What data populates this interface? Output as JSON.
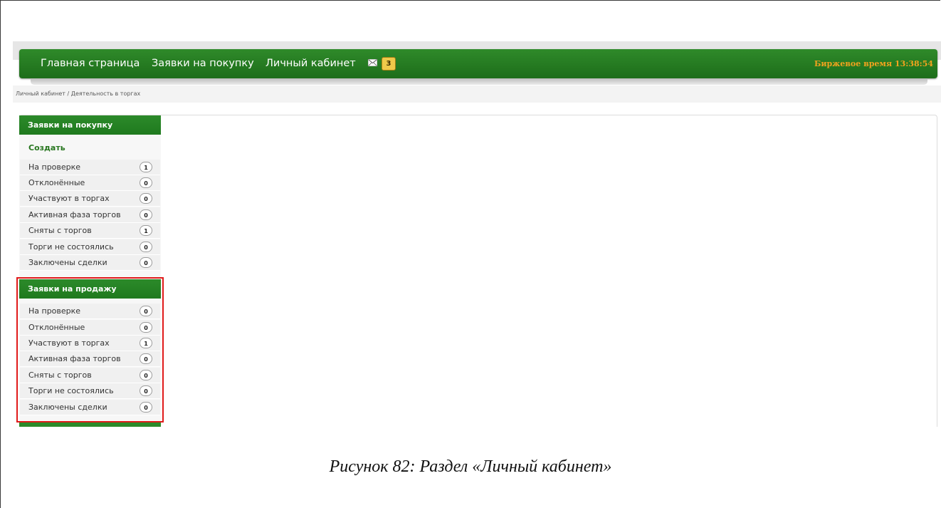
{
  "navbar": {
    "home": "Главная страница",
    "purchase_requests": "Заявки на покупку",
    "personal_account": "Личный кабинет",
    "mail_count": "3",
    "exchange_time": "Биржевое время 13:38:54"
  },
  "breadcrumb": "Личный кабинет / Деятельность в торгах",
  "sidebar": {
    "purchase_header": "Заявки на покупку",
    "create_label": "Создать",
    "purchase_items": [
      {
        "label": "На проверке",
        "count": "1"
      },
      {
        "label": "Отклонённые",
        "count": "0"
      },
      {
        "label": "Участвуют в торгах",
        "count": "0"
      },
      {
        "label": "Активная фаза торгов",
        "count": "0"
      },
      {
        "label": "Сняты с торгов",
        "count": "1"
      },
      {
        "label": "Торги не состоялись",
        "count": "0"
      },
      {
        "label": "Заключены сделки",
        "count": "0"
      }
    ],
    "sale_header": "Заявки на продажу",
    "sale_items": [
      {
        "label": "На проверке",
        "count": "0"
      },
      {
        "label": "Отклонённые",
        "count": "0"
      },
      {
        "label": "Участвуют в торгах",
        "count": "1"
      },
      {
        "label": "Активная фаза торгов",
        "count": "0"
      },
      {
        "label": "Сняты с торгов",
        "count": "0"
      },
      {
        "label": "Торги не состоялись",
        "count": "0"
      },
      {
        "label": "Заключены сделки",
        "count": "0"
      }
    ]
  },
  "caption": "Рисунок 82: Раздел «Личный кабинет»",
  "colors": {
    "nav_green": "#1d6d1a",
    "time_orange": "#f2a21e",
    "highlight_red": "#e01a1a",
    "badge_gold": "#efc94a"
  },
  "icons": {
    "mail": "envelope-icon"
  }
}
